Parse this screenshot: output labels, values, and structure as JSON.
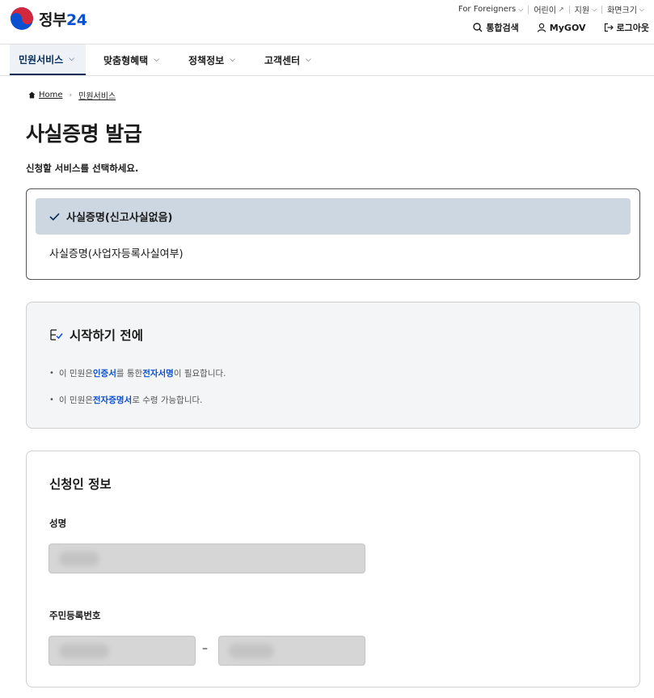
{
  "header": {
    "logo_text": "정부",
    "logo_num": "24",
    "util": [
      {
        "label": "For Foreigners",
        "icon": "chevron-down-icon"
      },
      {
        "label": "어린이",
        "icon": "external-link-icon"
      },
      {
        "label": "지원",
        "icon": "chevron-down-icon"
      },
      {
        "label": "화면크기",
        "icon": "chevron-down-icon"
      }
    ],
    "quick": {
      "search": "통합검색",
      "mygov": "MyGOV",
      "login": "로그아웃"
    }
  },
  "nav": {
    "items": [
      {
        "label": "민원서비스",
        "active": true
      },
      {
        "label": "맞춤형혜택",
        "active": false
      },
      {
        "label": "정책정보",
        "active": false
      },
      {
        "label": "고객센터",
        "active": false
      }
    ]
  },
  "breadcrumb": {
    "home": "Home",
    "current": "민원서비스"
  },
  "page": {
    "title": "사실증명 발급",
    "subtitle": "신청할 서비스를 선택하세요."
  },
  "services": {
    "selected": "사실증명(신고사실없음)",
    "other": "사실증명(사업자등록사실여부)"
  },
  "before": {
    "title": "시작하기 전에",
    "bullet1": {
      "pre": "이 민원은 ",
      "hl1": "인증서",
      "mid": "를 통한 ",
      "hl2": "전자서명",
      "post": "이 필요합니다."
    },
    "bullet2": {
      "pre": "이 민원은 ",
      "hl1": "전자증명서",
      "post": "로 수령 가능합니다."
    }
  },
  "applicant": {
    "title": "신청인 정보",
    "name_label": "성명",
    "rrn_label": "주민등록번호",
    "rrn_separator": "–"
  },
  "colors": {
    "primary_navy": "#052b57",
    "link_blue": "#0b50d0",
    "selected_bg": "#cdd7e2"
  }
}
